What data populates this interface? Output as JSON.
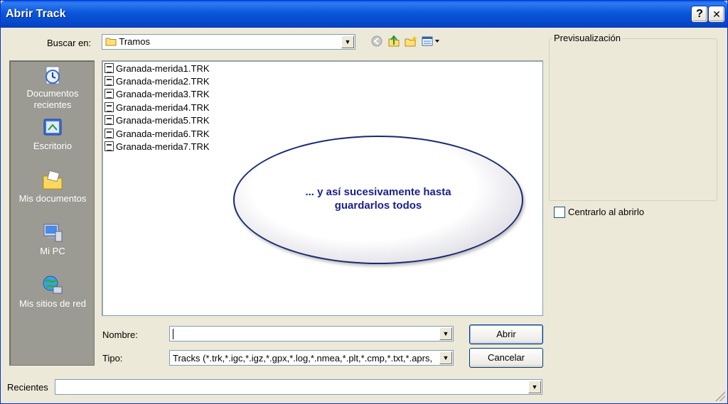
{
  "window": {
    "title": "Abrir Track"
  },
  "titlebar_buttons": {
    "help": "?",
    "close": "✕"
  },
  "lookin": {
    "label": "Buscar en:",
    "value": "Tramos"
  },
  "places": [
    {
      "label_line1": "Documentos",
      "label_line2": "recientes",
      "icon": "recent-documents-icon"
    },
    {
      "label_line1": "Escritorio",
      "label_line2": "",
      "icon": "desktop-icon"
    },
    {
      "label_line1": "Mis documentos",
      "label_line2": "",
      "icon": "my-documents-icon"
    },
    {
      "label_line1": "Mi PC",
      "label_line2": "",
      "icon": "my-computer-icon"
    },
    {
      "label_line1": "Mis sitios de red",
      "label_line2": "",
      "icon": "network-places-icon"
    }
  ],
  "files": [
    "Granada-merida1.TRK",
    "Granada-merida2.TRK",
    "Granada-merida3.TRK",
    "Granada-merida4.TRK",
    "Granada-merida5.TRK",
    "Granada-merida6.TRK",
    "Granada-merida7.TRK"
  ],
  "callout": {
    "line1": "... y así sucesivamente hasta",
    "line2": "guardarlos todos"
  },
  "filename": {
    "label": "Nombre:",
    "value": ""
  },
  "filetype": {
    "label": "Tipo:",
    "value": "Tracks (*.trk,*.igc,*.igz,*.gpx,*.log,*.nmea,*.plt,*.cmp,*.txt,*.aprs,"
  },
  "buttons": {
    "open": "Abrir",
    "cancel": "Cancelar"
  },
  "preview": {
    "label": "Previsualización",
    "center_label": "Centrarlo al abrirlo",
    "center_checked": false
  },
  "recent": {
    "label": "Recientes",
    "value": ""
  },
  "colors": {
    "titlebar": "#0a57da",
    "dialog_bg": "#ece9d8",
    "places_bg": "#9b9a93",
    "callout_text": "#1b1f8a"
  }
}
